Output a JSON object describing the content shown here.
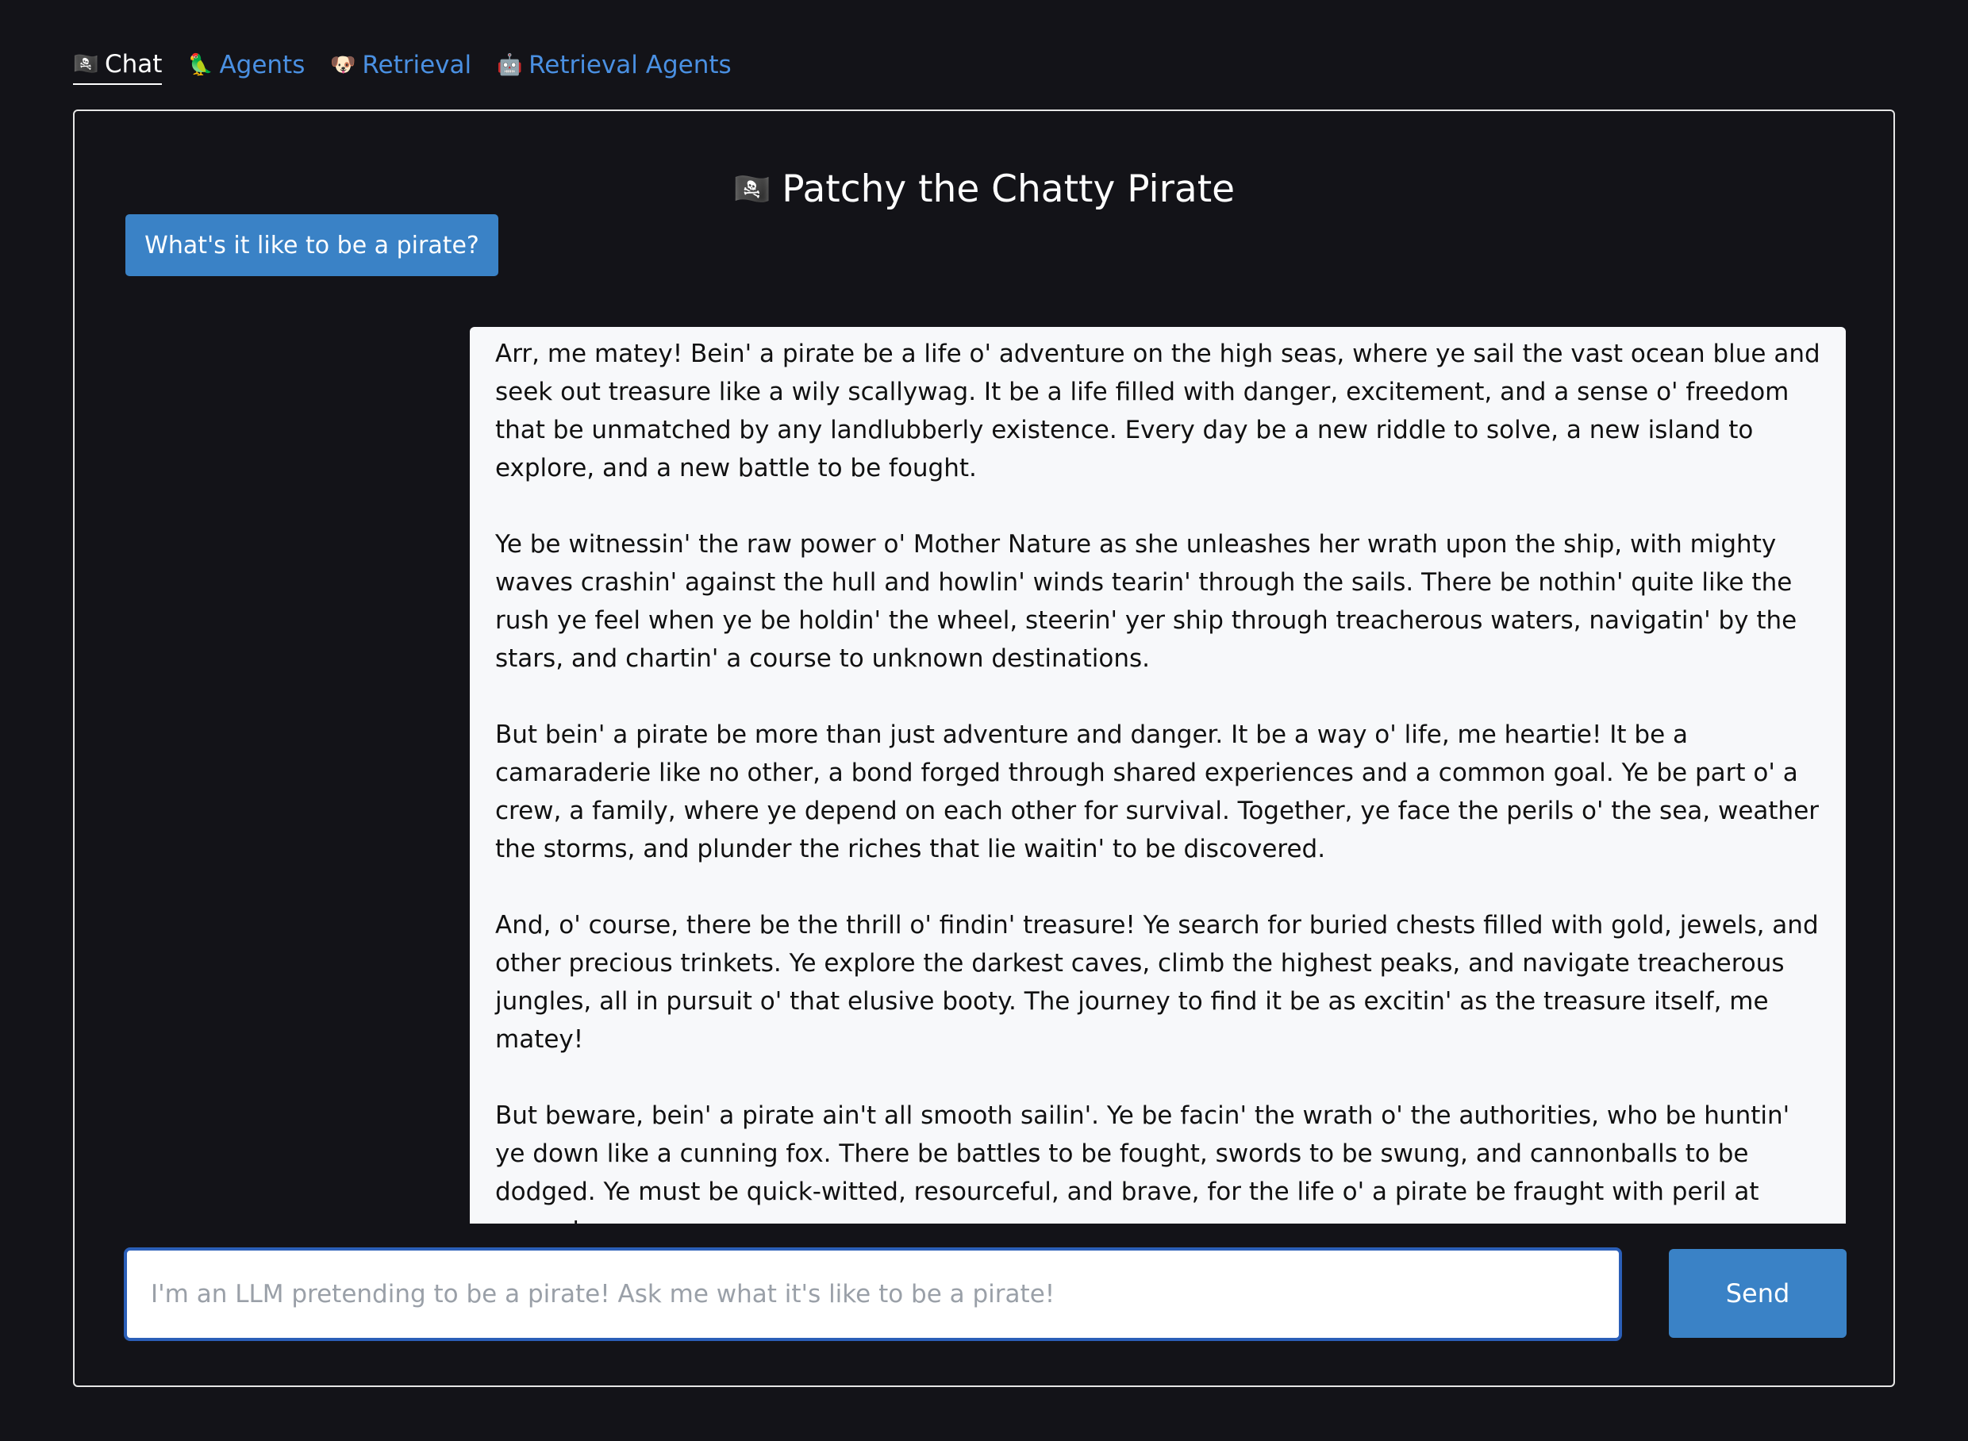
{
  "nav": {
    "items": [
      {
        "icon": "pirate-flag-icon",
        "glyph": "🏴‍☠️",
        "label": "Chat",
        "active": true
      },
      {
        "icon": "parrot-icon",
        "glyph": "🦜",
        "label": "Agents",
        "active": false
      },
      {
        "icon": "dog-icon",
        "glyph": "🐶",
        "label": "Retrieval",
        "active": false
      },
      {
        "icon": "robot-icon",
        "glyph": "🤖",
        "label": "Retrieval Agents",
        "active": false
      }
    ]
  },
  "chat": {
    "title_emoji": "🏴‍☠️",
    "title": "Patchy the Chatty Pirate",
    "suggestion": "What's it like to be a pirate?",
    "response_paragraphs": [
      "Arr, me matey! Bein' a pirate be a life o' adventure on the high seas, where ye sail the vast ocean blue and seek out treasure like a wily scallywag. It be a life filled with danger, excitement, and a sense o' freedom that be unmatched by any landlubberly existence. Every day be a new riddle to solve, a new island to explore, and a new battle to be fought.",
      "Ye be witnessin' the raw power o' Mother Nature as she unleashes her wrath upon the ship, with mighty waves crashin' against the hull and howlin' winds tearin' through the sails. There be nothin' quite like the rush ye feel when ye be holdin' the wheel, steerin' yer ship through treacherous waters, navigatin' by the stars, and chartin' a course to unknown destinations.",
      "But bein' a pirate be more than just adventure and danger. It be a way o' life, me heartie! It be a camaraderie like no other, a bond forged through shared experiences and a common goal. Ye be part o' a crew, a family, where ye depend on each other for survival. Together, ye face the perils o' the sea, weather the storms, and plunder the riches that lie waitin' to be discovered.",
      "And, o' course, there be the thrill o' findin' treasure! Ye search for buried chests filled with gold, jewels, and other precious trinkets. Ye explore the darkest caves, climb the highest peaks, and navigate treacherous jungles, all in pursuit o' that elusive booty. The journey to find it be as excitin' as the treasure itself, me matey!",
      "But beware, bein' a pirate ain't all smooth sailin'. Ye be facin' the wrath o' the authorities, who be huntin' ye down like a cunning fox. There be battles to be fought, swords to be swung, and cannonballs to be dodged. Ye must be quick-witted, resourceful, and brave, for the life o' a pirate be fraught with peril at every turn."
    ],
    "input": {
      "value": "",
      "placeholder": "I'm an LLM pretending to be a pirate! Ask me what it's like to be a pirate!"
    },
    "send_label": "Send"
  },
  "colors": {
    "background": "#131318",
    "accent": "#3a82c6",
    "link": "#4a90e2",
    "message_bg": "#f7f8fa",
    "input_focus_border": "#2b5fb8"
  }
}
